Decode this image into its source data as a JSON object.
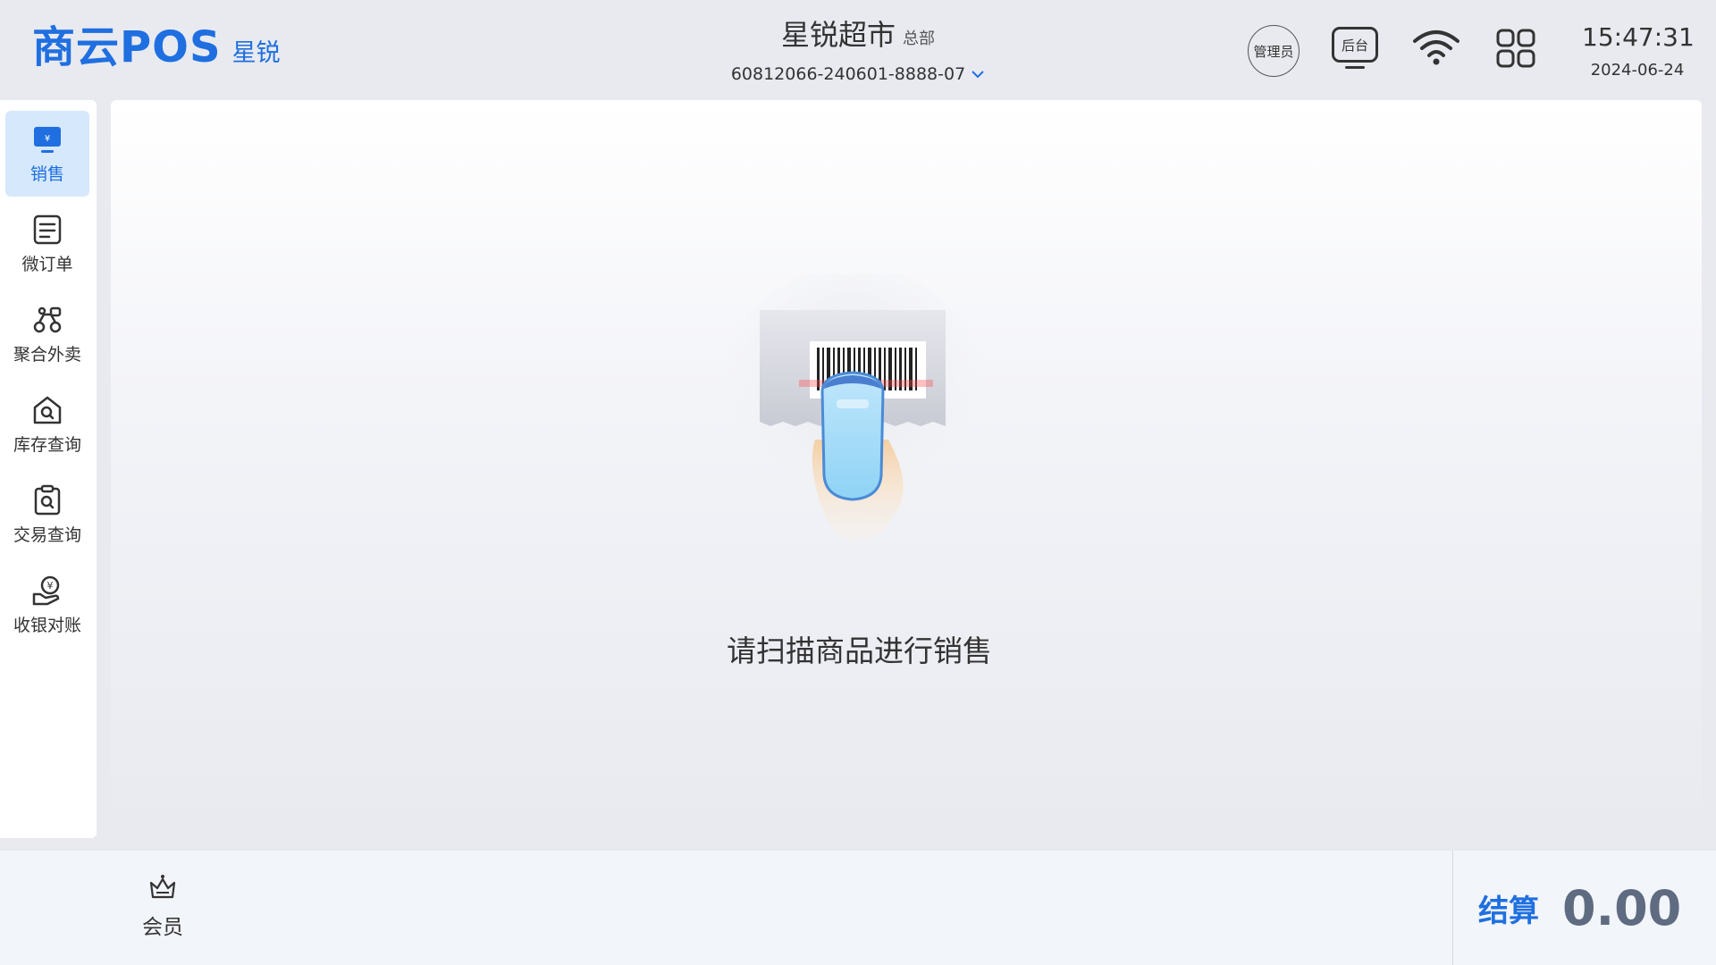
{
  "header": {
    "logo_main": "商云POS",
    "logo_sub": "星锐",
    "store_name": "星锐超市",
    "store_tag": "总部",
    "device_id": "60812066-240601-8888-07",
    "admin_label": "管理员",
    "backend_label": "后台",
    "time": "15:47:31",
    "date": "2024-06-24"
  },
  "sidebar": {
    "items": [
      {
        "label": "销售",
        "icon": "sale-monitor-icon",
        "active": true
      },
      {
        "label": "微订单",
        "icon": "order-list-icon",
        "active": false
      },
      {
        "label": "聚合外卖",
        "icon": "delivery-scooter-icon",
        "active": false
      },
      {
        "label": "库存查询",
        "icon": "inventory-search-icon",
        "active": false
      },
      {
        "label": "交易查询",
        "icon": "transaction-search-icon",
        "active": false
      },
      {
        "label": "收银对账",
        "icon": "reconcile-yen-icon",
        "active": false
      }
    ]
  },
  "main": {
    "prompt": "请扫描商品进行销售"
  },
  "bottom": {
    "member_label": "会员",
    "checkout_label": "结算",
    "checkout_amount": "0.00"
  },
  "colors": {
    "accent": "#1f6fe0",
    "active_bg": "#d6e8fc",
    "background": "#e8eaf0",
    "amount": "#5f6b80"
  }
}
